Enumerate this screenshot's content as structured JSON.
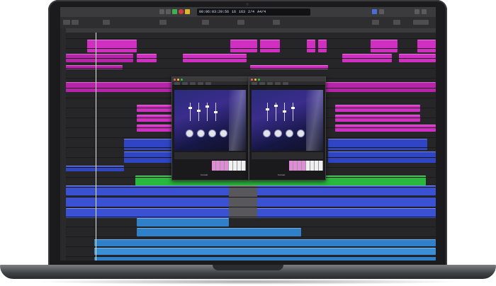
{
  "device": "laptop-with-daw",
  "transport": {
    "position": "00:06:03:29:56",
    "bars": "16",
    "tempo": "163",
    "signature": "2/4",
    "key": "A4/4"
  },
  "colors": {
    "magenta": "#d12fc2",
    "blue": "#2f45c4",
    "green": "#2ab73e",
    "audio_blue": "#2f7fc9",
    "play_green": "#3fb04f",
    "record_red": "#d53b3b"
  },
  "plugins": [
    {
      "brand": "Kontakt"
    },
    {
      "brand": "Kontakt"
    }
  ],
  "icons": [
    "play-icon",
    "record-icon",
    "cycle-icon",
    "rewind-icon",
    "forward-icon",
    "camera-icon"
  ]
}
